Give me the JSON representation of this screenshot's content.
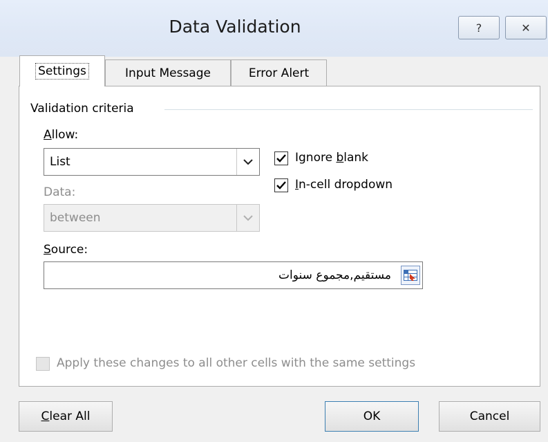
{
  "dialog": {
    "title": "Data Validation",
    "help_label": "?",
    "close_label": "✕"
  },
  "tabs": [
    {
      "label": "Settings",
      "active": true
    },
    {
      "label": "Input Message",
      "active": false
    },
    {
      "label": "Error Alert",
      "active": false
    }
  ],
  "settings": {
    "section_title": "Validation criteria",
    "allow": {
      "label_hotkey": "A",
      "label_rest": "llow:",
      "value": "List"
    },
    "data": {
      "label": "Data:",
      "value": "between",
      "enabled": false
    },
    "source": {
      "label_hotkey": "S",
      "label_rest": "ource:",
      "value": "مستقيم,مجموع سنوات"
    },
    "ignore_blank": {
      "label_pre": "Ignore ",
      "label_hotkey": "b",
      "label_rest": "lank",
      "checked": true
    },
    "incell_dropdown": {
      "label_hotkey": "I",
      "label_rest": "n-cell dropdown",
      "checked": true
    },
    "apply_all": {
      "label": "Apply these changes to all other cells with the same settings",
      "checked": false,
      "enabled": false
    }
  },
  "buttons": {
    "clear_hotkey": "C",
    "clear_rest": "lear All",
    "ok": "OK",
    "cancel": "Cancel"
  },
  "colors": {
    "titlebar": "#dfe8f6",
    "panel": "#ffffff",
    "dialog_bg": "#f0f0f0",
    "disabled_text": "#8d8d8d"
  }
}
